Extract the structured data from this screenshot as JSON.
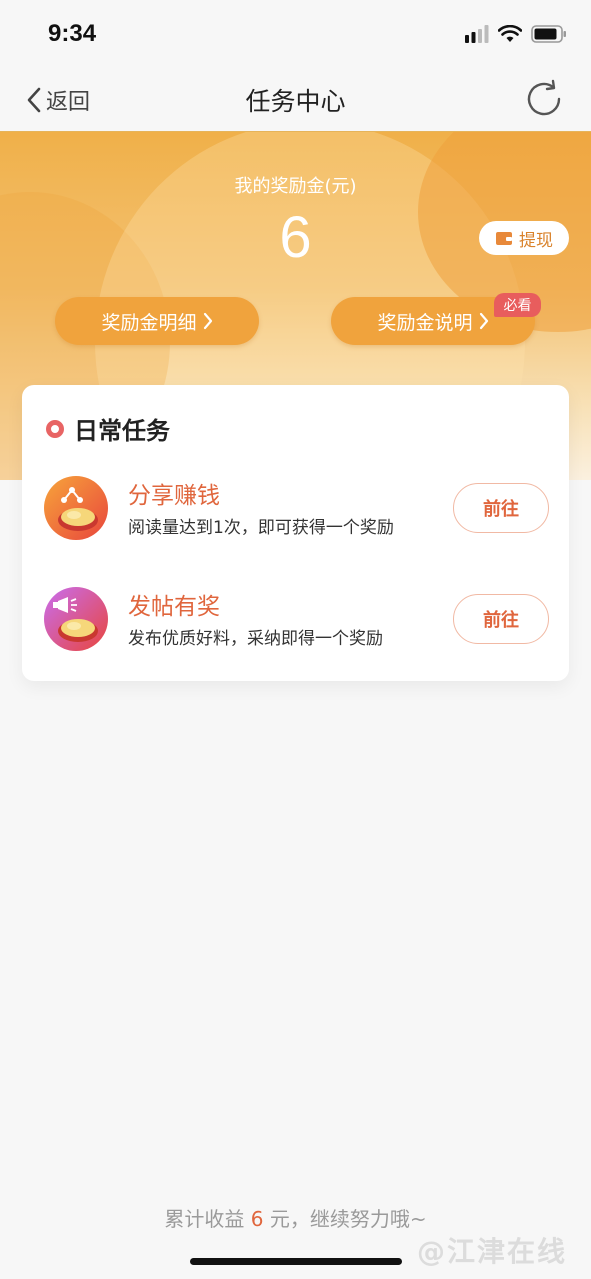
{
  "status_bar": {
    "time": "9:34"
  },
  "nav": {
    "back_label": "返回",
    "title": "任务中心"
  },
  "reward": {
    "label": "我的奖励金(元)",
    "value": "6",
    "withdraw_label": "提现",
    "detail_button": "奖励金明细",
    "explain_button": "奖励金说明",
    "must_see_badge": "必看"
  },
  "daily_tasks": {
    "title": "日常任务",
    "items": [
      {
        "name": "分享赚钱",
        "description": "阅读量达到1次，即可获得一个奖励",
        "action": "前往"
      },
      {
        "name": "发帖有奖",
        "description": "发布优质好料，采纳即得一个奖励",
        "action": "前往"
      }
    ]
  },
  "footer": {
    "prefix": "累计收益",
    "amount": "6",
    "suffix": "元，继续努力哦~",
    "watermark": "@江津在线"
  },
  "colors": {
    "accent": "#e0663d",
    "banner_orange": "#f0b049",
    "pill_orange": "#f0a33d",
    "badge_red": "#e85d5d"
  }
}
